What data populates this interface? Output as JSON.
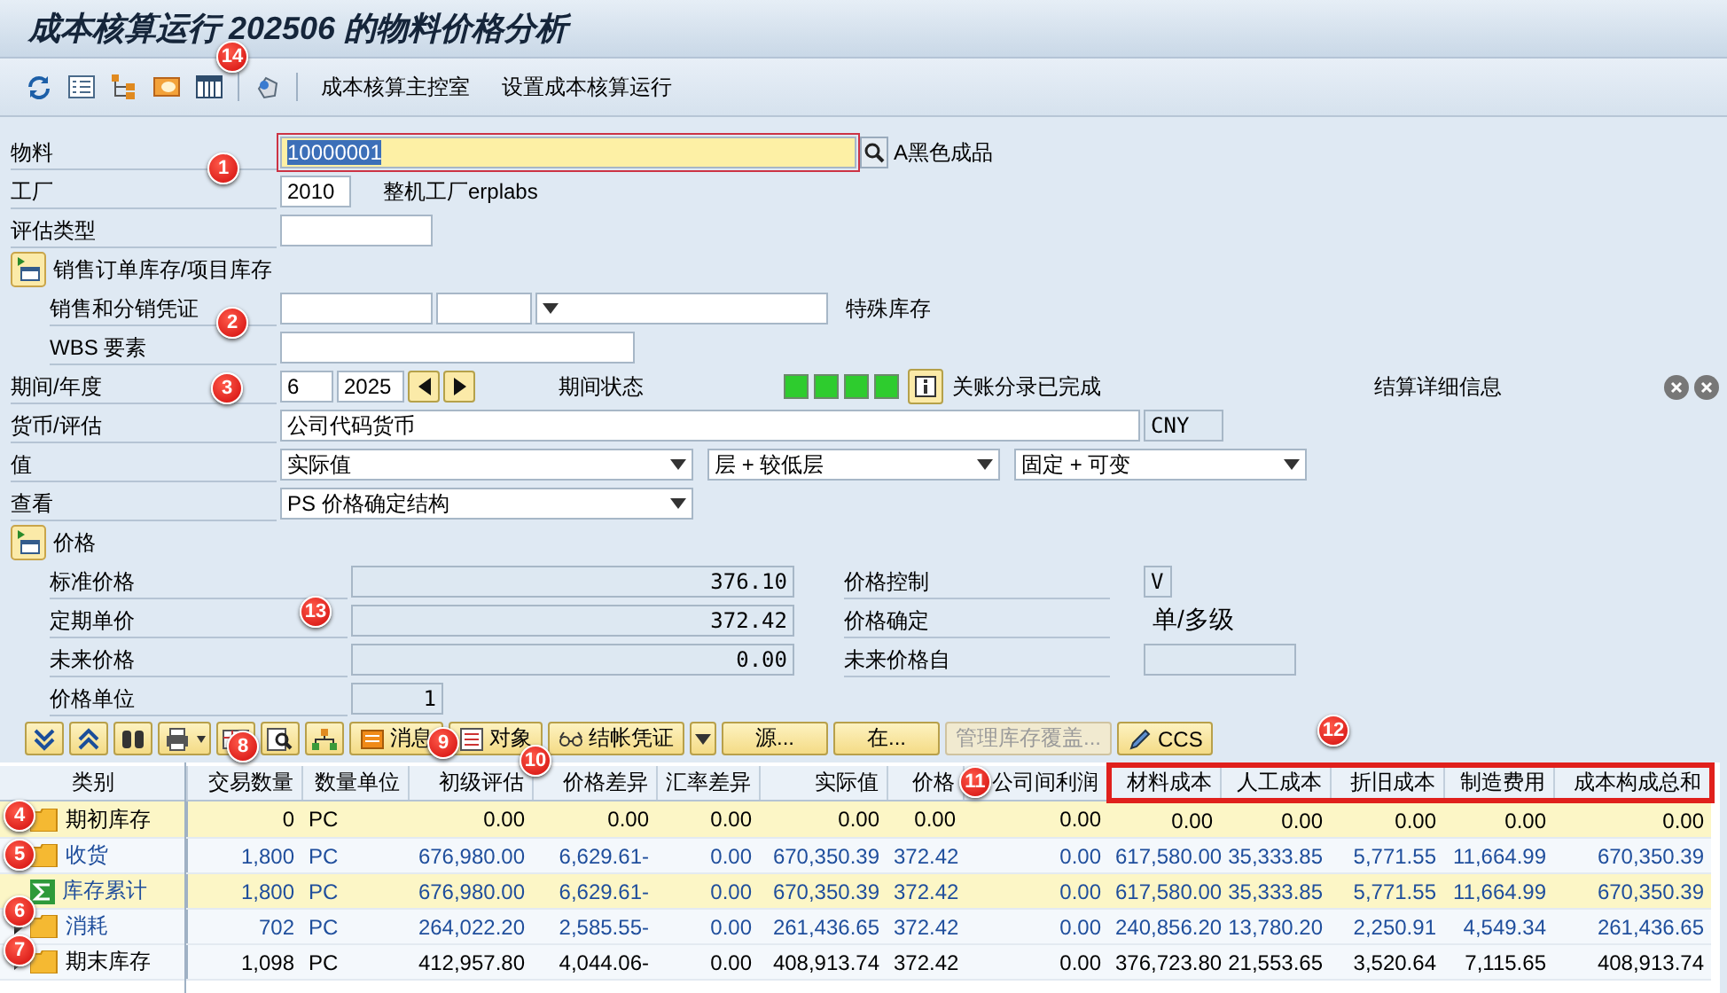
{
  "window": {
    "title": "成本核算运行 202506 的物料价格分析"
  },
  "toolbar": {
    "buttons": [
      "成本核算主控室",
      "设置成本核算运行"
    ]
  },
  "material": {
    "label": "物料",
    "value": "10000001",
    "description": "A黑色成品"
  },
  "plant": {
    "label": "工厂",
    "value": "2010",
    "description": "整机工厂erplabs"
  },
  "valuation_type": {
    "label": "评估类型"
  },
  "sales_order_stock": {
    "label": "销售订单库存/项目库存"
  },
  "sd_document": {
    "label": "销售和分销凭证",
    "special_stock_label": "特殊库存"
  },
  "wbs": {
    "label": "WBS 要素"
  },
  "period": {
    "label": "期间/年度",
    "period": "6",
    "year": "2025",
    "status_label": "期间状态",
    "status_lights": [
      {
        "on": true
      },
      {
        "on": true
      },
      {
        "on": true
      },
      {
        "on": true
      }
    ],
    "status_text": "关账分录已完成",
    "settlement_label": "结算详细信息"
  },
  "currency": {
    "label": "货币/评估",
    "value": "公司代码货币",
    "currency": "CNY"
  },
  "value": {
    "label": "值",
    "selections": [
      "实际值",
      "层 + 较低层",
      "固定 + 可变"
    ]
  },
  "view": {
    "label": "查看",
    "value": "PS 价格确定结构"
  },
  "price_section": {
    "label": "价格",
    "rows": [
      {
        "label": "标准价格",
        "value": "376.10",
        "kind": "control",
        "right_label": "价格控制",
        "right_value": "V"
      },
      {
        "label": "定期单价",
        "value": "372.42",
        "kind": "determination",
        "right_label": "价格确定",
        "right_value": "单/多级"
      },
      {
        "label": "未来价格",
        "value": "0.00",
        "kind": "date",
        "right_label": "未来价格自"
      },
      {
        "label": "价格单位",
        "value": "1",
        "kind": "unit"
      }
    ]
  },
  "table_toolbar": {
    "buttons": [
      {
        "label": "消息",
        "disabled": false,
        "menu": false
      },
      {
        "label": "对象",
        "disabled": false,
        "menu": false
      },
      {
        "label": "结帐凭证",
        "disabled": false,
        "menu": true
      },
      {
        "label": "源...",
        "disabled": false,
        "menu": false
      },
      {
        "label": "在...",
        "disabled": false,
        "menu": false
      },
      {
        "label": "管理库存覆盖...",
        "disabled": true,
        "menu": false
      },
      {
        "label": "CCS",
        "disabled": false,
        "menu": false
      }
    ]
  },
  "table": {
    "columns": [
      {
        "label": "类别",
        "marked": false
      },
      {
        "label": "交易数量",
        "marked": false
      },
      {
        "label": "数量单位",
        "marked": false
      },
      {
        "label": "初级评估",
        "marked": false
      },
      {
        "label": "价格差异",
        "marked": false
      },
      {
        "label": "汇率差异",
        "marked": false
      },
      {
        "label": "实际值",
        "marked": false
      },
      {
        "label": "价格",
        "marked": false
      },
      {
        "label": "公司间利润",
        "marked": false
      },
      {
        "label": "材料成本",
        "marked": true
      },
      {
        "label": "人工成本",
        "marked": true
      },
      {
        "label": "折旧成本",
        "marked": true
      },
      {
        "label": "制造费用",
        "marked": true
      },
      {
        "label": "成本构成总和",
        "marked": true
      }
    ],
    "rows": [
      {
        "kind": "folder",
        "highlighted": true,
        "color": "#000000",
        "cells": [
          "期初库存",
          "0",
          "PC",
          "0.00",
          "0.00",
          "0.00",
          "0.00",
          "0.00",
          "0.00",
          "0.00",
          "0.00",
          "0.00",
          "0.00",
          "0.00"
        ]
      },
      {
        "kind": "folder",
        "highlighted": false,
        "color": "#1f4e9c",
        "cells": [
          "收货",
          "1,800",
          "PC",
          "676,980.00",
          "6,629.61-",
          "0.00",
          "670,350.39",
          "372.42",
          "0.00",
          "617,580.00",
          "35,333.85",
          "5,771.55",
          "11,664.99",
          "670,350.39"
        ]
      },
      {
        "kind": "sum",
        "highlighted": true,
        "color": "#1f4e9c",
        "cells": [
          "库存累计",
          "1,800",
          "PC",
          "676,980.00",
          "6,629.61-",
          "0.00",
          "670,350.39",
          "372.42",
          "0.00",
          "617,580.00",
          "35,333.85",
          "5,771.55",
          "11,664.99",
          "670,350.39"
        ]
      },
      {
        "kind": "folder",
        "highlighted": false,
        "color": "#1f4e9c",
        "cells": [
          "消耗",
          "702",
          "PC",
          "264,022.20",
          "2,585.55-",
          "0.00",
          "261,436.65",
          "372.42",
          "0.00",
          "240,856.20",
          "13,780.20",
          "2,250.91",
          "4,549.34",
          "261,436.65"
        ]
      },
      {
        "kind": "folder",
        "highlighted": false,
        "color": "#000000",
        "cells": [
          "期末库存",
          "1,098",
          "PC",
          "412,957.80",
          "4,044.06-",
          "0.00",
          "408,913.74",
          "372.42",
          "0.00",
          "376,723.80",
          "21,553.65",
          "3,520.64",
          "7,115.65",
          "408,913.74"
        ]
      }
    ]
  },
  "callouts": [
    "1",
    "2",
    "3",
    "4",
    "5",
    "6",
    "7",
    "8",
    "9",
    "10",
    "11",
    "12",
    "13",
    "14"
  ]
}
